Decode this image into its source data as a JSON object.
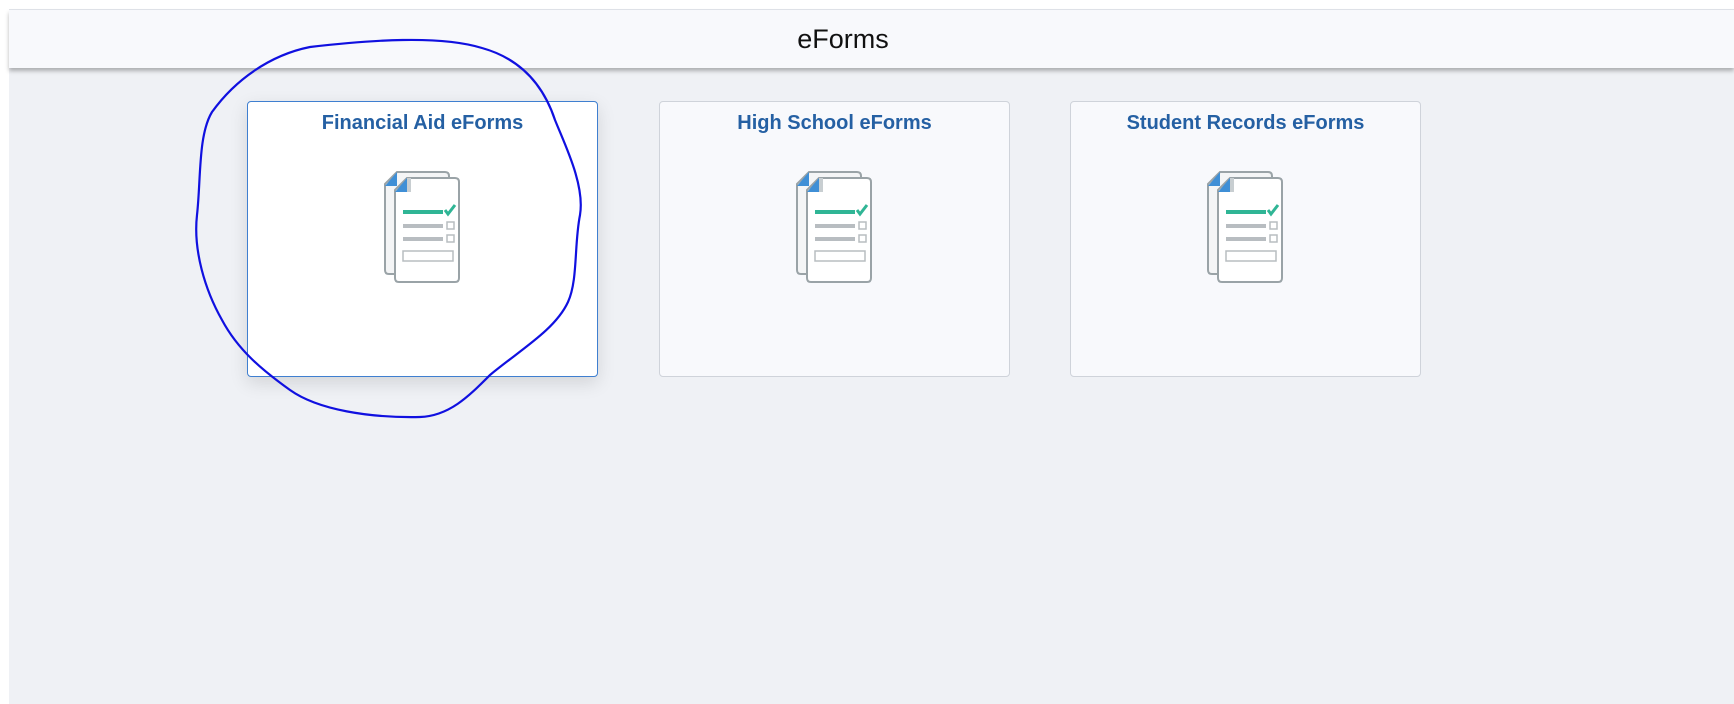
{
  "header": {
    "title": "eForms"
  },
  "tiles": [
    {
      "label": "Financial Aid eForms",
      "icon": "form-checklist-icon"
    },
    {
      "label": "High School eForms",
      "icon": "form-checklist-icon"
    },
    {
      "label": "Student Records eForms",
      "icon": "form-checklist-icon"
    }
  ],
  "colors": {
    "tile_title": "#2560a3",
    "active_border": "#3f7fd0",
    "icon_green": "#2fb595",
    "icon_blue": "#3f8fd6",
    "annotation_ink": "#1010e0"
  }
}
